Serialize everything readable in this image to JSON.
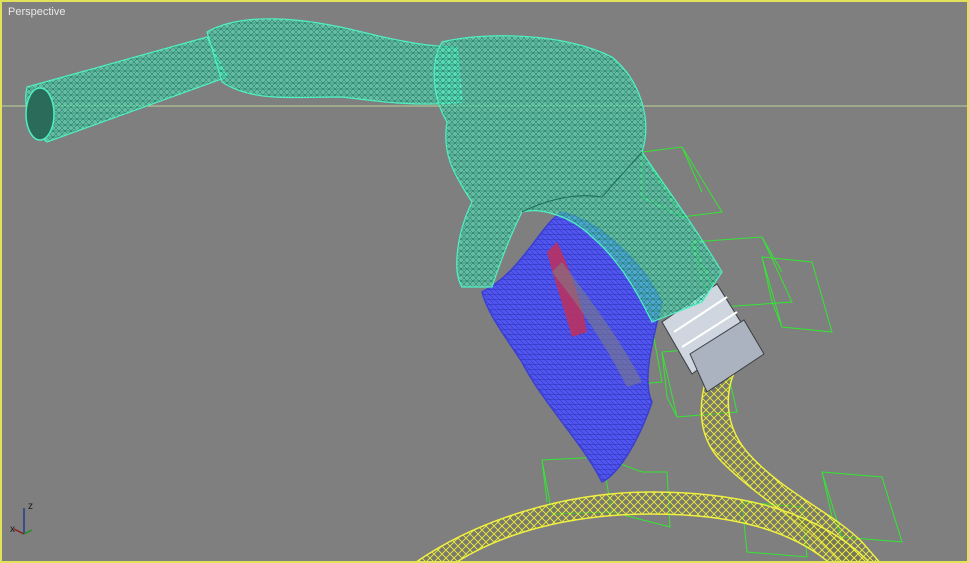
{
  "viewport": {
    "label": "Perspective",
    "border_color": "#e2e25a",
    "background": "#7f7f7f"
  },
  "scene": {
    "nozzle_color": "#4ff0c0",
    "trigger_color": "#4f55ee",
    "trigger_inner_color": "#c0305a",
    "hose_color": "#f0f040",
    "helper_color": "#33e633",
    "ferrule_color": "#cfd6df"
  },
  "axis_gizmo": {
    "z_label": "z",
    "x_label": "x"
  }
}
